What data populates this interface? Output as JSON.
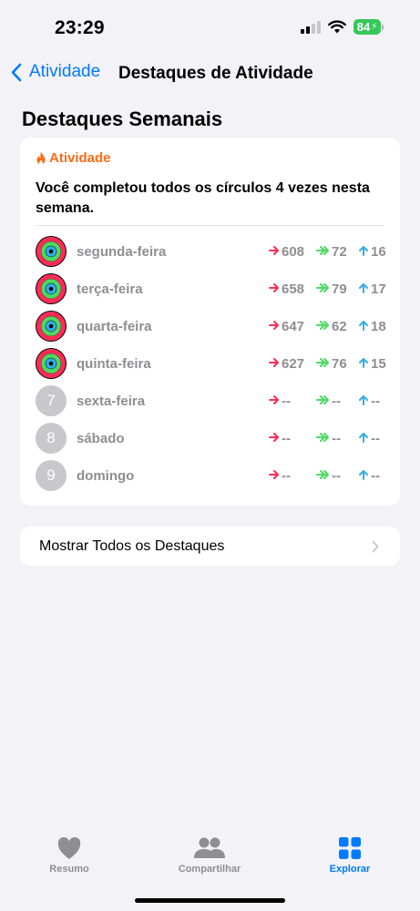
{
  "status_bar": {
    "time": "23:29",
    "battery": "84"
  },
  "nav": {
    "back_label": "Atividade",
    "title": "Destaques de Atividade"
  },
  "section_title": "Destaques Semanais",
  "card": {
    "tag": "Atividade",
    "summary": "Você completou todos os círculos 4 vezes nesta semana.",
    "days": [
      {
        "name": "segunda-feira",
        "closed": true,
        "move": "608",
        "exercise": "72",
        "stand": "16"
      },
      {
        "name": "terça-feira",
        "closed": true,
        "move": "658",
        "exercise": "79",
        "stand": "17"
      },
      {
        "name": "quarta-feira",
        "closed": true,
        "move": "647",
        "exercise": "62",
        "stand": "18"
      },
      {
        "name": "quinta-feira",
        "closed": true,
        "move": "627",
        "exercise": "76",
        "stand": "15"
      },
      {
        "name": "sexta-feira",
        "closed": false,
        "day_number": "7",
        "move": "--",
        "exercise": "--",
        "stand": "--"
      },
      {
        "name": "sábado",
        "closed": false,
        "day_number": "8",
        "move": "--",
        "exercise": "--",
        "stand": "--"
      },
      {
        "name": "domingo",
        "closed": false,
        "day_number": "9",
        "move": "--",
        "exercise": "--",
        "stand": "--"
      }
    ]
  },
  "show_all_label": "Mostrar Todos os Destaques",
  "tabs": [
    {
      "label": "Resumo",
      "icon": "heart-icon",
      "active": false
    },
    {
      "label": "Compartilhar",
      "icon": "people-icon",
      "active": false
    },
    {
      "label": "Explorar",
      "icon": "grid-icon",
      "active": true
    }
  ],
  "colors": {
    "accent": "#007aff",
    "move": "#ff2d55",
    "exercise": "#4cd964",
    "stand": "#32ade6",
    "activity_tag": "#ff6a13"
  }
}
